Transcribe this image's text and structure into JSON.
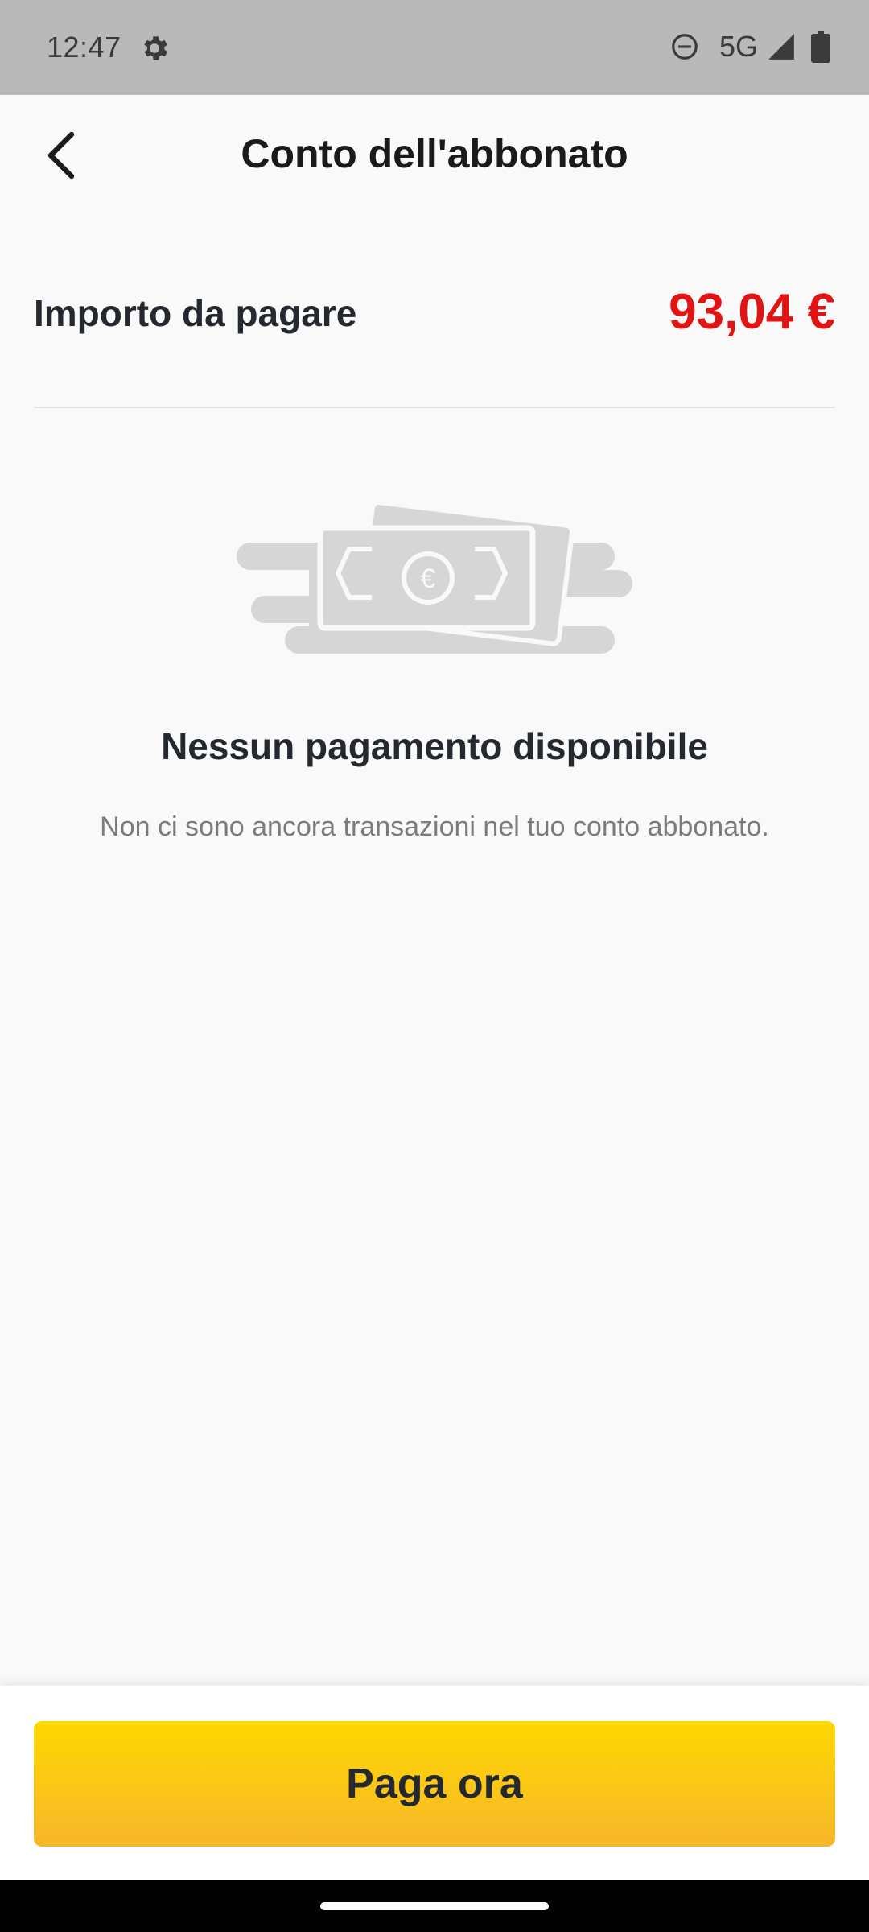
{
  "status_bar": {
    "time": "12:47",
    "network": "5G",
    "icons": [
      "gear-icon",
      "do-not-disturb-icon",
      "signal-icon",
      "battery-icon"
    ]
  },
  "header": {
    "title": "Conto dell'abbonato",
    "back_icon": "chevron-left-icon"
  },
  "amount": {
    "label": "Importo da pagare",
    "value": "93,04 €",
    "value_color": "#e11414"
  },
  "empty_state": {
    "icon": "banknote-euro-icon",
    "title": "Nessun pagamento disponibile",
    "subtitle": "Non ci sono ancora transazioni nel tuo conto abbonato."
  },
  "actions": {
    "pay_label": "Paga ora",
    "pay_color": "#ffd800"
  }
}
